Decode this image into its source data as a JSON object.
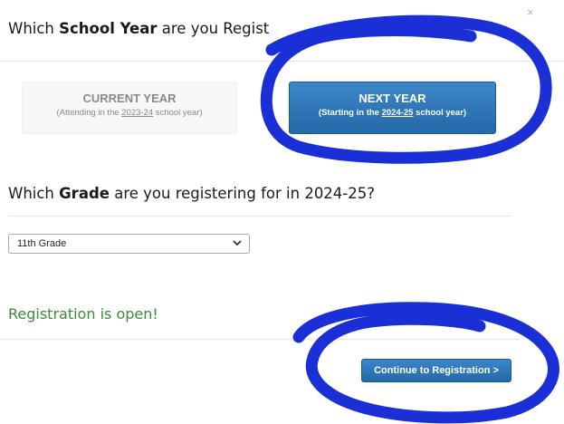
{
  "modal": {
    "close_symbol": "×",
    "year_question": {
      "prefix": "Which ",
      "bold": "School Year",
      "suffix": " are you Regist"
    },
    "year_options": {
      "current": {
        "title": "CURRENT YEAR",
        "sub_prefix": "(Attending in the ",
        "sub_year": "2023-24",
        "sub_suffix": " school year)"
      },
      "next": {
        "title": "NEXT YEAR",
        "sub_prefix": "(Starting in the ",
        "sub_year": "2024-25",
        "sub_suffix": " school year)"
      }
    },
    "grade_question": {
      "prefix": "Which ",
      "bold": "Grade",
      "suffix": " are you registering for in 2024-25?"
    },
    "grade_select": {
      "selected": "11th Grade"
    },
    "status": "Registration is open!",
    "continue_label": "Continue to Registration >"
  },
  "colors": {
    "primary_button": "#2f78bb",
    "status_green": "#3b8a3a",
    "annotation_ink": "#1a2fd6"
  }
}
